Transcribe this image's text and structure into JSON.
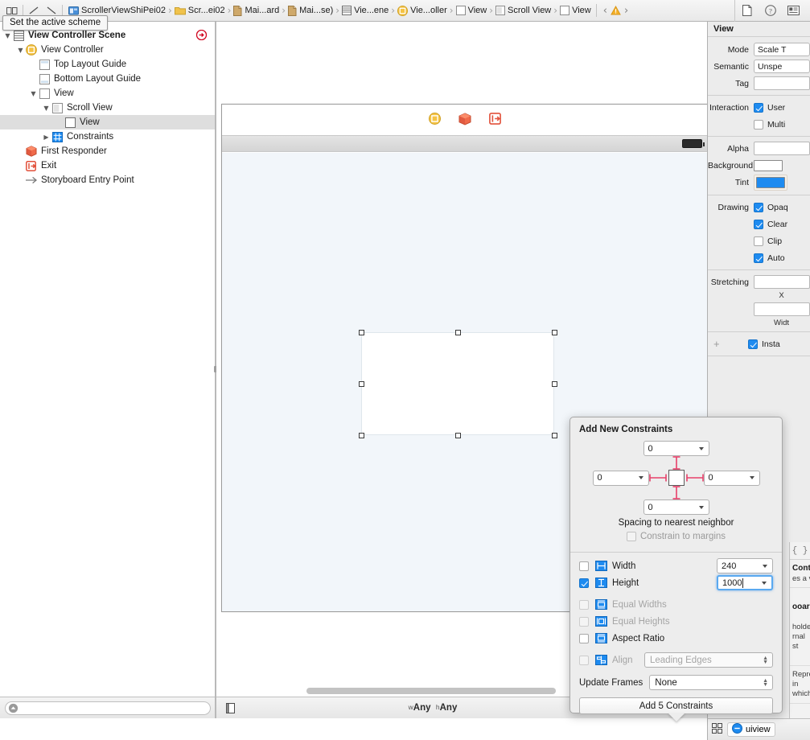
{
  "toolbar": {
    "icons": [
      {
        "name": "editor-toggle-icon",
        "glyph": "▭▭"
      },
      {
        "name": "forward-slash-icon",
        "glyph": "╱"
      },
      {
        "name": "back-slash-icon",
        "glyph": "╲"
      }
    ]
  },
  "tooltip": {
    "text": "Set the active scheme"
  },
  "breadcrumb": {
    "items": [
      {
        "label": "ScrollerViewShiPei02",
        "icon": "project-icon"
      },
      {
        "label": "Scr...ei02",
        "icon": "folder-icon"
      },
      {
        "label": "Mai...ard",
        "icon": "file-icon"
      },
      {
        "label": "Mai...se)",
        "icon": "file-icon"
      },
      {
        "label": "Vie...ene",
        "icon": "scene-icon"
      },
      {
        "label": "Vie...oller",
        "icon": "view-controller-icon"
      },
      {
        "label": "View",
        "icon": "view-icon"
      },
      {
        "label": "Scroll View",
        "icon": "scroll-view-icon"
      },
      {
        "label": "View",
        "icon": "view-icon"
      }
    ],
    "prev_arrow": "‹",
    "next_arrow": "›",
    "warning_icon": "warning-icon"
  },
  "utility_icons": [
    {
      "name": "file-inspector-icon"
    },
    {
      "name": "quick-help-icon"
    },
    {
      "name": "identity-inspector-icon"
    }
  ],
  "navigator": {
    "tree": [
      {
        "label": "View Controller Scene",
        "depth": 0,
        "disclosure": "open",
        "icon": "scene-icon",
        "bold": true,
        "selected": false,
        "badge": "error-badge"
      },
      {
        "label": "View Controller",
        "depth": 1,
        "disclosure": "open",
        "icon": "view-controller-icon",
        "bold": false,
        "selected": false
      },
      {
        "label": "Top Layout Guide",
        "depth": 2,
        "disclosure": "none",
        "icon": "top-layout-guide-icon",
        "bold": false,
        "selected": false
      },
      {
        "label": "Bottom Layout Guide",
        "depth": 2,
        "disclosure": "none",
        "icon": "bottom-layout-guide-icon",
        "bold": false,
        "selected": false
      },
      {
        "label": "View",
        "depth": 2,
        "disclosure": "open",
        "icon": "view-icon",
        "bold": false,
        "selected": false
      },
      {
        "label": "Scroll View",
        "depth": 3,
        "disclosure": "open",
        "icon": "scroll-view-icon",
        "bold": false,
        "selected": false
      },
      {
        "label": "View",
        "depth": 4,
        "disclosure": "none",
        "icon": "view-icon",
        "bold": false,
        "selected": true
      },
      {
        "label": "Constraints",
        "depth": 3,
        "disclosure": "closed",
        "icon": "constraints-icon",
        "bold": false,
        "selected": false
      },
      {
        "label": "First Responder",
        "depth": 1,
        "disclosure": "none",
        "icon": "first-responder-icon",
        "bold": false,
        "selected": false
      },
      {
        "label": "Exit",
        "depth": 1,
        "disclosure": "none",
        "icon": "exit-icon",
        "bold": false,
        "selected": false
      },
      {
        "label": "Storyboard Entry Point",
        "depth": 1,
        "disclosure": "none",
        "icon": "entry-point-icon",
        "bold": false,
        "selected": false
      }
    ],
    "filter_placeholder": ""
  },
  "canvas": {
    "dock_icons": [
      {
        "name": "view-controller-dock-icon"
      },
      {
        "name": "first-responder-dock-icon"
      },
      {
        "name": "exit-dock-icon"
      }
    ],
    "size_class": {
      "width_prefix": "w",
      "width_value": "Any",
      "height_prefix": "h",
      "height_value": "Any"
    },
    "bottom_icons": [
      {
        "name": "document-outline-icon"
      },
      {
        "name": "auto-layout-resolve-icon"
      },
      {
        "name": "auto-layout-pin-icon"
      },
      {
        "name": "auto-layout-align-icon"
      },
      {
        "name": "auto-layout-stack-icon"
      }
    ]
  },
  "inspector": {
    "title": "View",
    "rows": [
      {
        "label": "Mode",
        "value": "Scale T",
        "type": "combo",
        "name": "mode-combo"
      },
      {
        "label": "Semantic",
        "value": "Unspe",
        "type": "combo",
        "name": "semantic-combo"
      },
      {
        "label": "Tag",
        "value": "",
        "type": "field",
        "name": "tag-field"
      }
    ],
    "interaction": {
      "label": "Interaction",
      "items": [
        {
          "label": "User",
          "checked": true,
          "name": "user-interaction-enabled-checkbox"
        },
        {
          "label": "Multi",
          "checked": false,
          "name": "multiple-touch-checkbox"
        }
      ]
    },
    "alpha": {
      "label": "Alpha",
      "value": ""
    },
    "background": {
      "label": "Background",
      "color": "#ffffff"
    },
    "tint": {
      "label": "Tint",
      "color": "#1e8bf0"
    },
    "drawing": {
      "label": "Drawing",
      "items": [
        {
          "label": "Opaq",
          "checked": true,
          "name": "opaque-checkbox"
        },
        {
          "label": "Clear",
          "checked": true,
          "name": "clears-graphics-context-checkbox"
        },
        {
          "label": "Clip",
          "checked": false,
          "name": "clip-to-bounds-checkbox"
        },
        {
          "label": "Auto",
          "checked": true,
          "name": "autoresize-subviews-checkbox"
        }
      ]
    },
    "stretching": {
      "label": "Stretching",
      "x_caption": "X",
      "width_caption": "Widt"
    },
    "installed": {
      "label": "Insta",
      "checked": true,
      "plus": "+"
    }
  },
  "popover": {
    "title": "Add New Constraints",
    "spacing": {
      "top": "0",
      "left": "0",
      "right": "0",
      "bottom": "0",
      "caption": "Spacing to nearest neighbor",
      "constrain_to_margins": {
        "label": "Constrain to margins",
        "checked": false,
        "enabled": false
      }
    },
    "constraints": [
      {
        "label": "Width",
        "checked": false,
        "enabled": true,
        "value": "240",
        "control": "combo",
        "icon": "width-constraint-icon",
        "name": "width-constraint-row",
        "focused": false
      },
      {
        "label": "Height",
        "checked": true,
        "enabled": true,
        "value": "1000",
        "control": "combo",
        "icon": "height-constraint-icon",
        "name": "height-constraint-row",
        "focused": true
      },
      {
        "label": "Equal Widths",
        "checked": false,
        "enabled": false,
        "value": "",
        "control": "none",
        "icon": "equal-widths-icon",
        "name": "equal-widths-row",
        "focused": false
      },
      {
        "label": "Equal Heights",
        "checked": false,
        "enabled": false,
        "value": "",
        "control": "none",
        "icon": "equal-heights-icon",
        "name": "equal-heights-row",
        "focused": false
      },
      {
        "label": "Aspect Ratio",
        "checked": false,
        "enabled": true,
        "value": "",
        "control": "none",
        "icon": "aspect-ratio-icon",
        "name": "aspect-ratio-row",
        "focused": false
      }
    ],
    "align": {
      "label": "Align",
      "checked": false,
      "enabled": false,
      "value": "Leading Edges",
      "icon": "align-icon"
    },
    "update_frames": {
      "label": "Update Frames",
      "value": "None"
    },
    "add_button": "Add 5 Constraints"
  },
  "library": {
    "search_glyph": "{ }",
    "items": [
      {
        "title": "Contro",
        "desc": "es a vie"
      },
      {
        "title": "ooard",
        "desc": "holder\nrnal st"
      },
      {
        "title": "",
        "desc": "Repre\nin which"
      }
    ]
  },
  "status_bar": {
    "object_label": "uiview",
    "grid_icon": "grid-icon",
    "object_icon": "uiview-icon"
  }
}
